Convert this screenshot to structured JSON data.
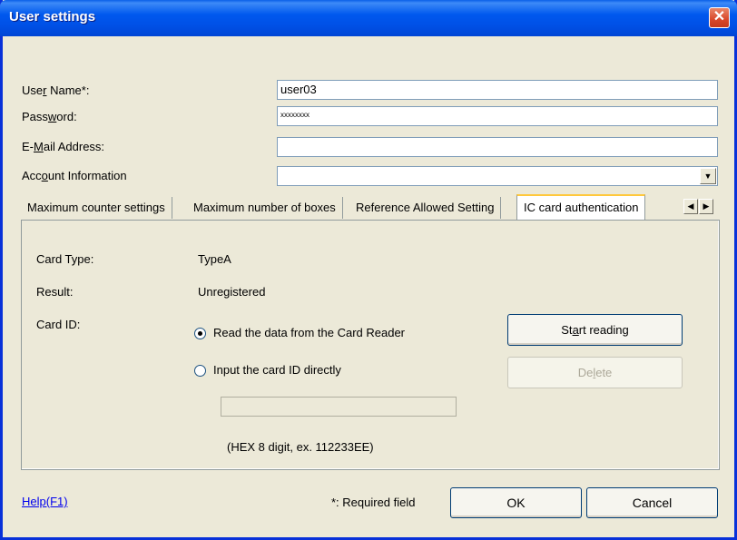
{
  "window": {
    "title": "User settings"
  },
  "form": {
    "user_name": {
      "label_pre": "Use",
      "label_key": "r",
      "label_post": " Name*:",
      "value": "user03"
    },
    "password": {
      "label_pre": "Pass",
      "label_key": "w",
      "label_post": "ord:",
      "value": "xxxxxxxx"
    },
    "email": {
      "label_pre": "E-",
      "label_key": "M",
      "label_post": "ail Address:",
      "value": ""
    },
    "account": {
      "label_pre": "Acc",
      "label_key": "o",
      "label_post": "unt Information",
      "value": ""
    }
  },
  "tabs": [
    {
      "label": "Maximum counter settings"
    },
    {
      "label": "Maximum number of boxes"
    },
    {
      "label": "Reference Allowed Setting"
    },
    {
      "label": "IC card authentication"
    }
  ],
  "ic_card": {
    "card_type_label": "Card Type:",
    "card_type_value": "TypeA",
    "result_label": "Result:",
    "result_value": "Unregistered",
    "card_id_label": "Card ID:",
    "radio_read": "Read the data from the Card Reader",
    "radio_input": "Input the card ID directly",
    "hex_hint": "(HEX 8 digit, ex. 112233EE)",
    "start_pre": "St",
    "start_key": "a",
    "start_post": "rt reading",
    "delete_pre": "De",
    "delete_key": "l",
    "delete_post": "ete"
  },
  "footer": {
    "help": "Help(F1)",
    "required_note": "*: Required field",
    "ok": "OK",
    "cancel": "Cancel"
  }
}
